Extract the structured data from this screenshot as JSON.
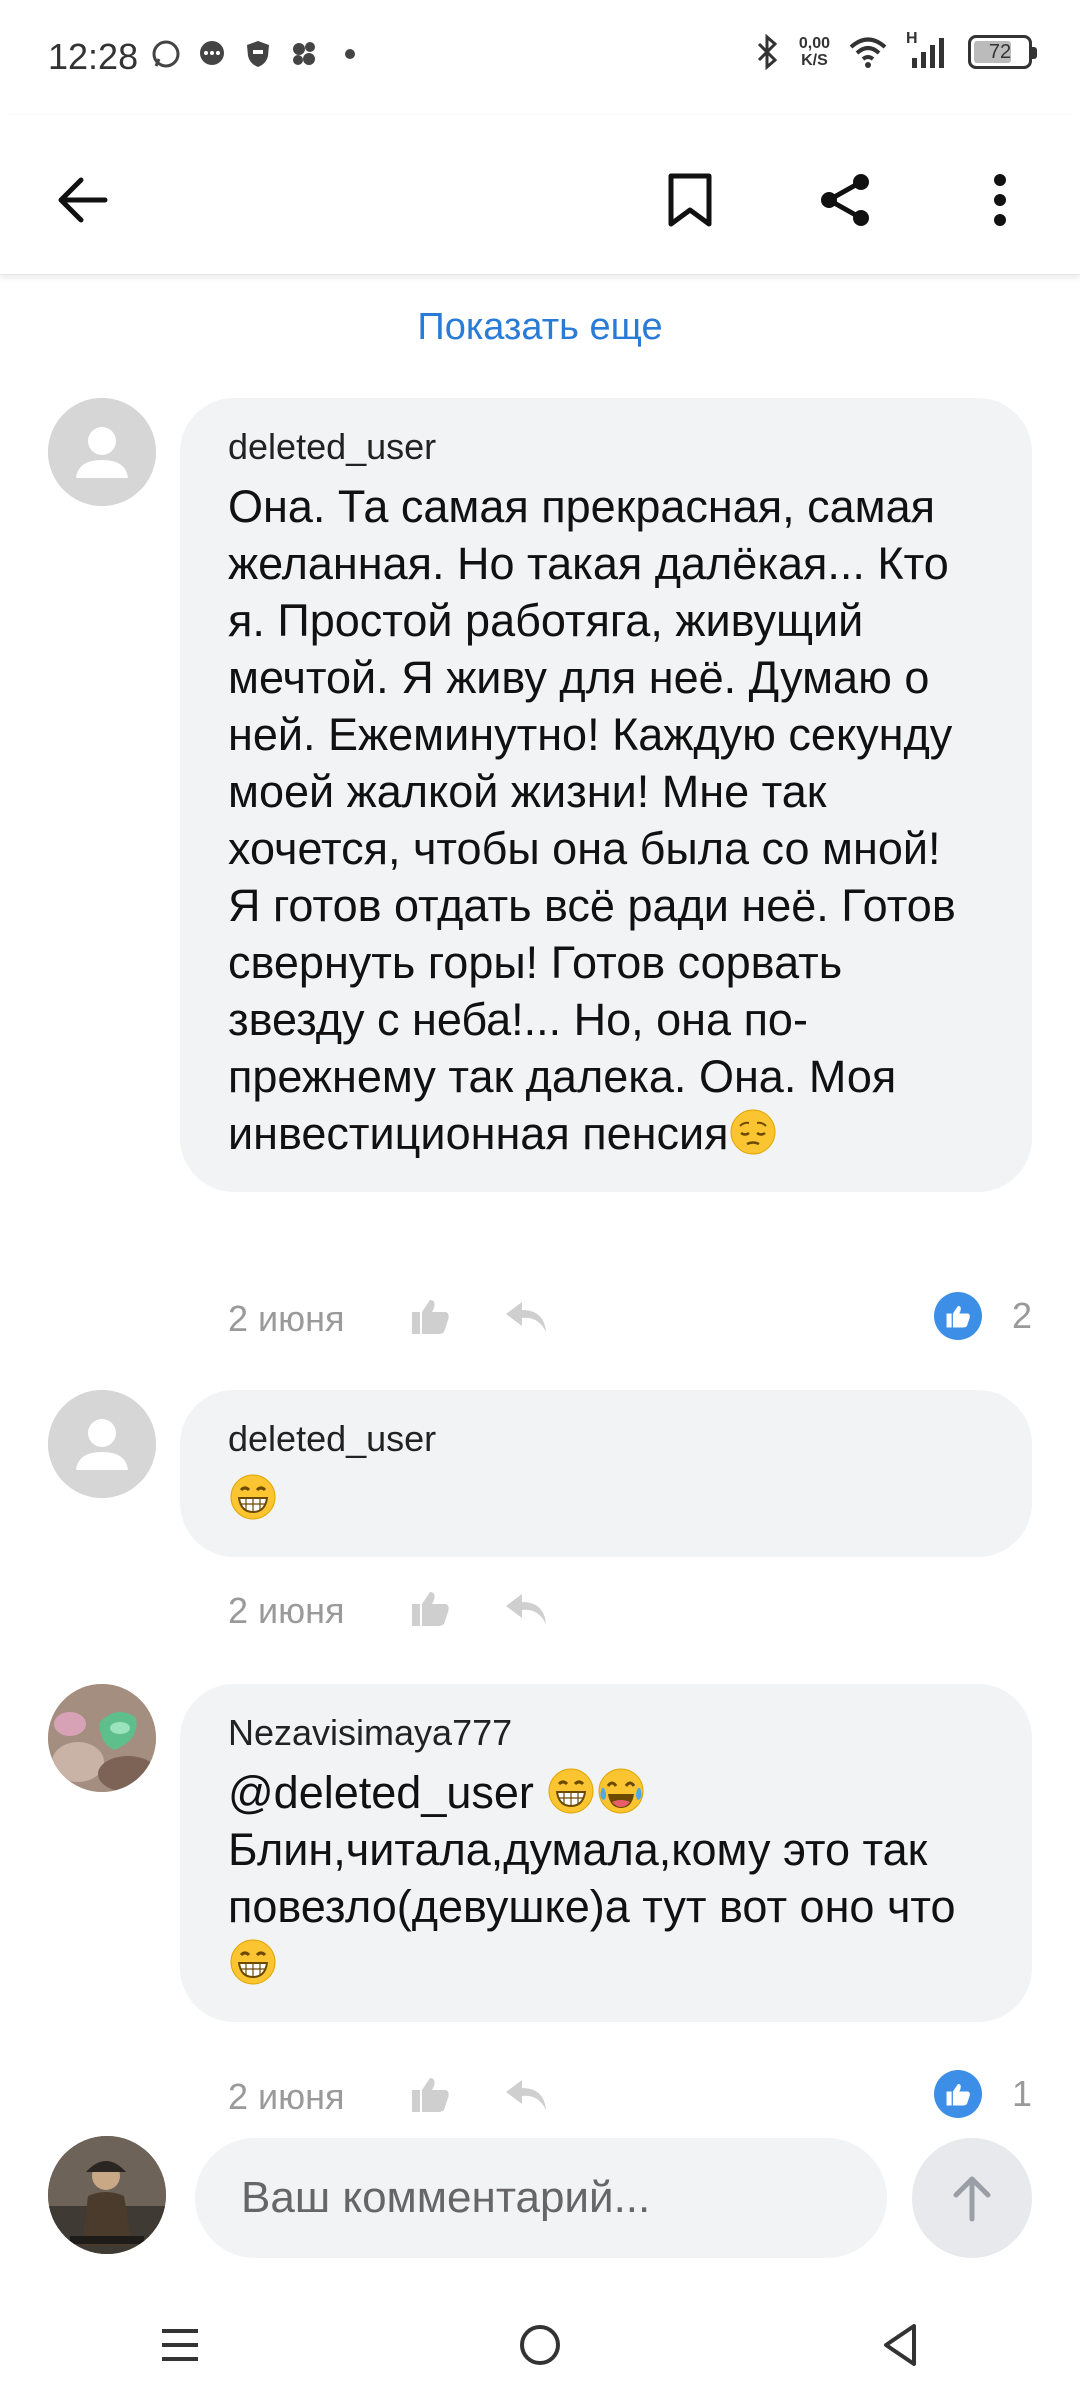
{
  "status_bar": {
    "time": "12:28",
    "net_speed_value": "0,00",
    "net_speed_unit": "K/S",
    "signal_label": "H",
    "battery": "72",
    "battery_level": 0.72,
    "icons": [
      "whatsapp-icon",
      "messenger-icon",
      "vpn-shield-icon",
      "app-icon",
      "dot-icon",
      "bluetooth-icon",
      "wifi-icon",
      "signal-icon",
      "battery-icon"
    ]
  },
  "toolbar": {
    "icons": [
      "back-arrow-icon",
      "bookmark-icon",
      "share-icon",
      "more-vertical-icon"
    ]
  },
  "feed": {
    "show_more": "Показать еще",
    "comments": [
      {
        "author": "deleted_user",
        "text": "Она. Та самая прекрасная, самая желанная. Но такая далёкая... Кто я. Простой работяга, живущий мечтой. Я живу для неё. Думаю о ней. Ежеминутно! Каждую секунду моей жалкой жизни! Мне так хочется, чтобы она была со мной! Я готов отдать всё ради неё. Готов свернуть горы! Готов сорвать звезду с неба!... Но, она по-прежнему так далека. Она. Моя инвестиционная пенсия",
        "emoji": "pensive-face",
        "date": "2 июня",
        "likes": "2"
      },
      {
        "author": "deleted_user",
        "text": "",
        "emoji": "grinning-face",
        "date": "2 июня",
        "likes": ""
      },
      {
        "author": "Nezavisimaya777",
        "mention": "@deleted_user",
        "text": "Блин,читала,думала,кому это так повезло(девушке)а тут вот оно что",
        "emoji": "grinning-face",
        "date": "2 июня",
        "likes": "1"
      }
    ]
  },
  "composer": {
    "placeholder": "Ваш комментарий..."
  },
  "colors": {
    "accent": "#2a7bd8",
    "like_blue": "#3d8ee6",
    "bubble_bg": "#f2f3f5",
    "meta_gray": "#9a9a9a"
  }
}
